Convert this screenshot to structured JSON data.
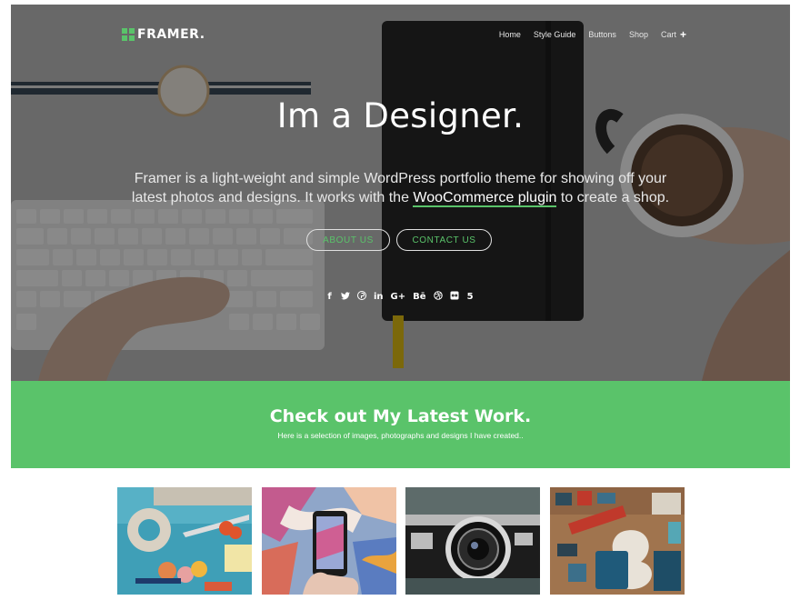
{
  "brand": {
    "name": "FRAMER.",
    "accent_color": "#5ac36a"
  },
  "nav": {
    "items": [
      {
        "label": "Home"
      },
      {
        "label": "Style Guide"
      },
      {
        "label": "Buttons"
      },
      {
        "label": "Shop"
      },
      {
        "label": "Cart"
      }
    ],
    "cart_icon": "plus-icon"
  },
  "hero": {
    "title": "Im a Designer.",
    "desc_before": "Framer is a light-weight and simple WordPress portfolio theme for showing off your latest photos and designs. It works with the ",
    "desc_link": "WooCommerce plugin",
    "desc_after": " to create a shop.",
    "buttons": {
      "about": "ABOUT US",
      "contact": "CONTACT US"
    },
    "socials": [
      {
        "icon": "facebook-icon",
        "glyph": "f"
      },
      {
        "icon": "twitter-icon",
        "glyph": "🐦"
      },
      {
        "icon": "pinterest-icon",
        "glyph": "℗"
      },
      {
        "icon": "linkedin-icon",
        "glyph": "in"
      },
      {
        "icon": "google-plus-icon",
        "glyph": "G+"
      },
      {
        "icon": "behance-icon",
        "glyph": "Bē"
      },
      {
        "icon": "dribbble-icon",
        "glyph": "⊛"
      },
      {
        "icon": "flickr-icon",
        "glyph": "⧉"
      },
      {
        "icon": "500px-icon",
        "glyph": "5"
      }
    ]
  },
  "latest": {
    "title": "Check out My Latest Work.",
    "subtitle": "Here is a selection of images, photographs and designs I have created.."
  },
  "gallery": [
    {
      "name": "craft-tools-thumbnail"
    },
    {
      "name": "phone-art-thumbnail"
    },
    {
      "name": "vintage-camera-thumbnail"
    },
    {
      "name": "letterpress-thumbnail"
    }
  ]
}
